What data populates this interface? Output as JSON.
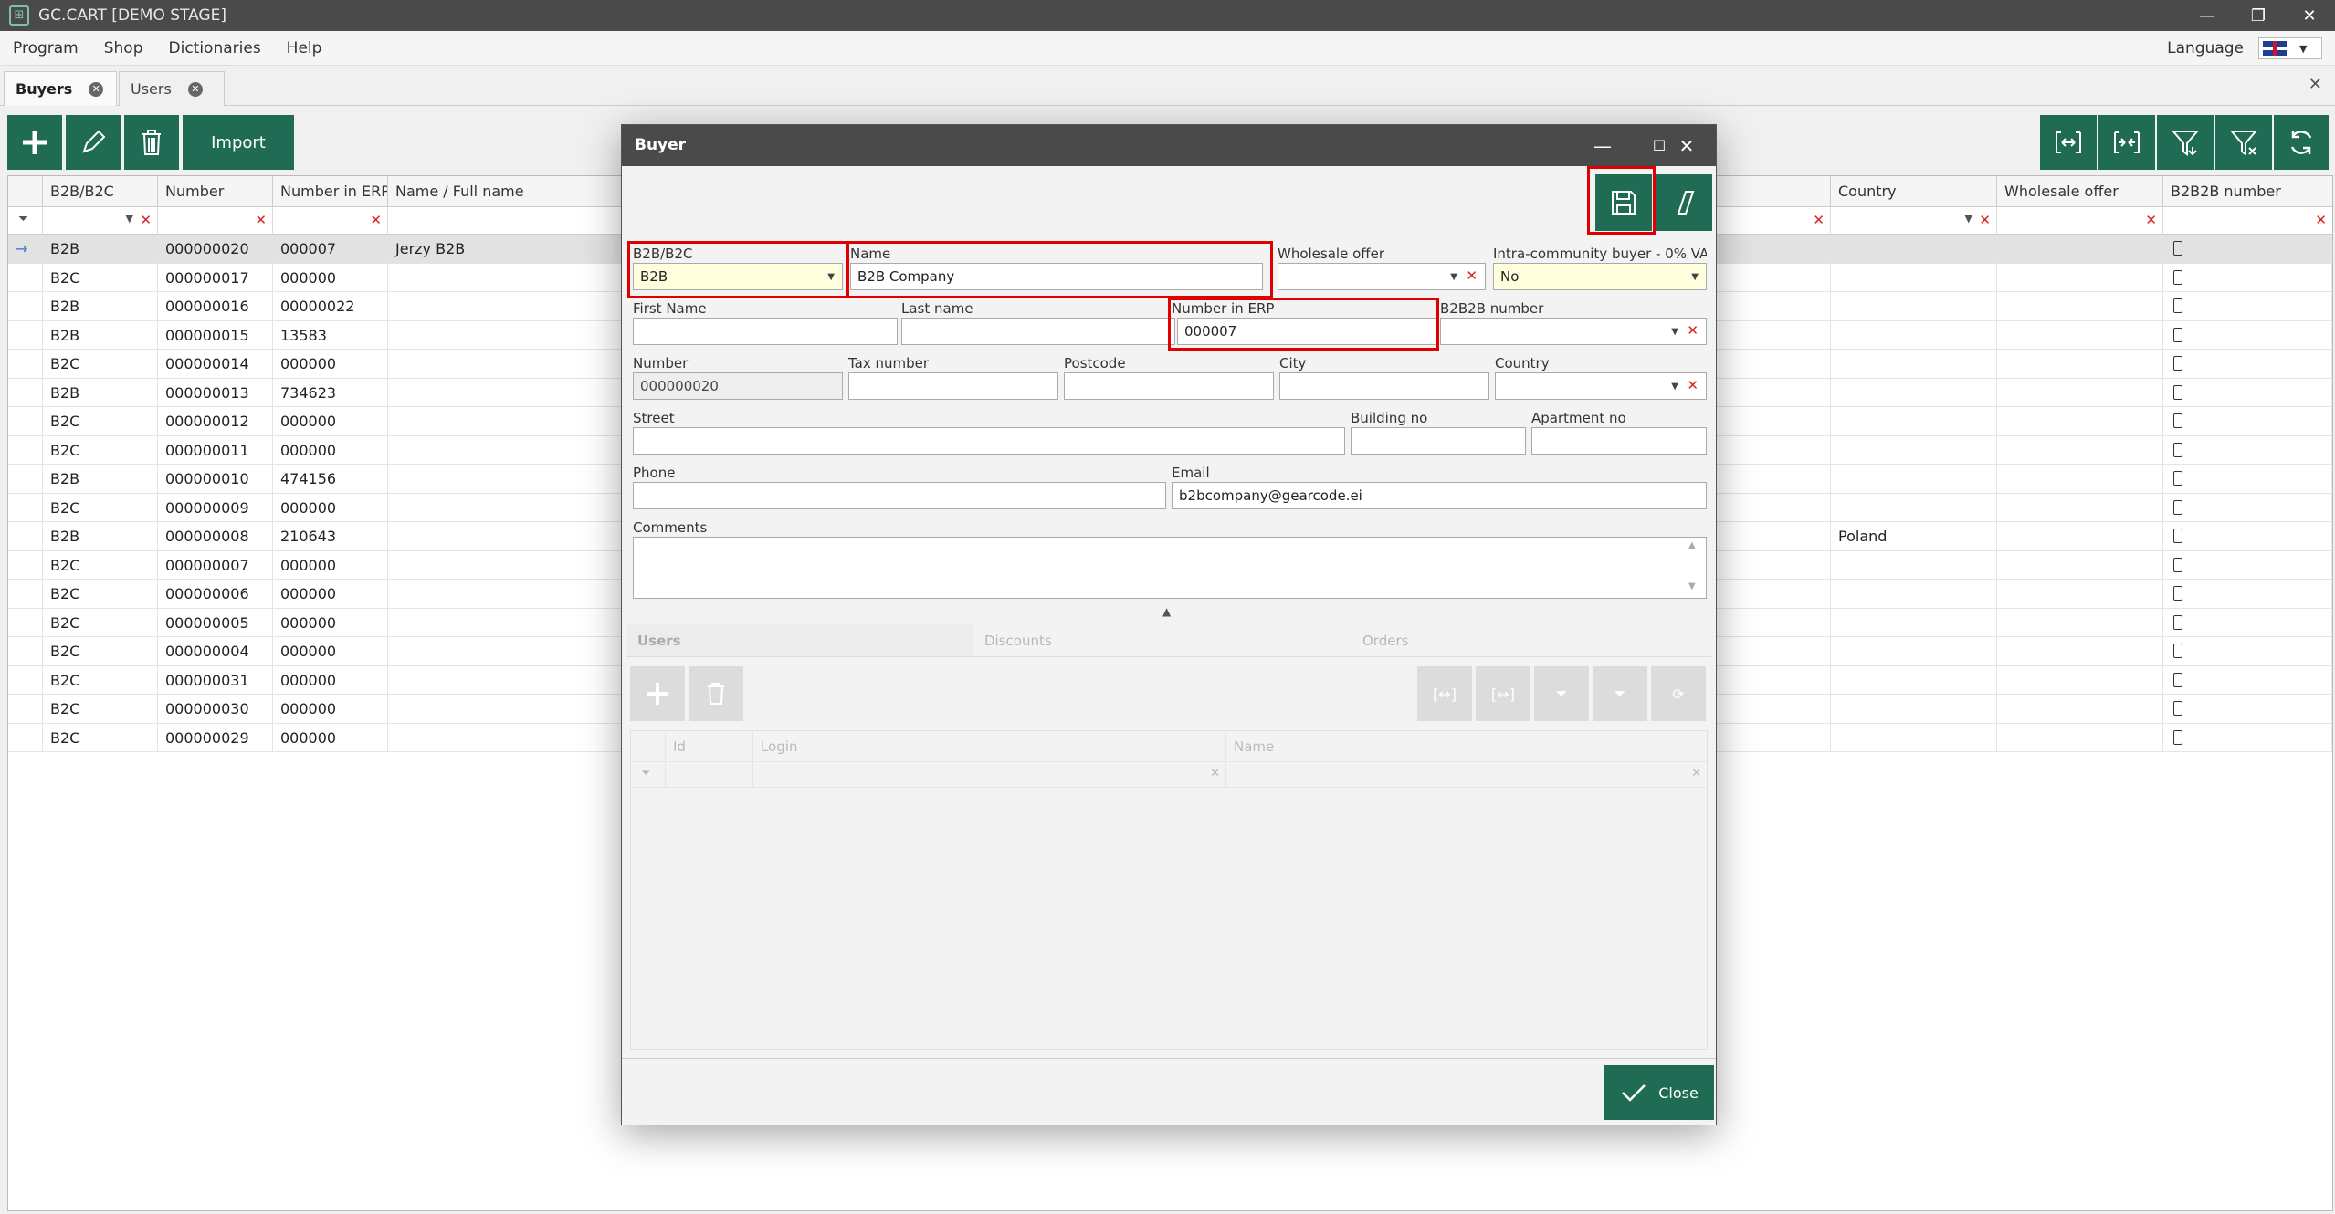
{
  "app": {
    "title": "GC.CART [DEMO STAGE]"
  },
  "menu": {
    "items": [
      "Program",
      "Shop",
      "Dictionaries",
      "Help"
    ],
    "language_label": "Language"
  },
  "tabs": [
    {
      "label": "Buyers"
    },
    {
      "label": "Users"
    }
  ],
  "toolbar": {
    "import_label": "Import"
  },
  "grid": {
    "columns": [
      "B2B/B2C",
      "Number",
      "Number in ERP",
      "Name / Full name",
      "Country",
      "Wholesale offer",
      "B2B2B number"
    ],
    "rows": [
      {
        "type": "B2B",
        "number": "000000020",
        "erp": "000007",
        "name": "Jerzy B2B",
        "country": ""
      },
      {
        "type": "B2C",
        "number": "000000017",
        "erp": "000000",
        "name": "",
        "country": ""
      },
      {
        "type": "B2B",
        "number": "000000016",
        "erp": "00000022",
        "name": "",
        "country": ""
      },
      {
        "type": "B2B",
        "number": "000000015",
        "erp": "13583",
        "name": "",
        "country": ""
      },
      {
        "type": "B2C",
        "number": "000000014",
        "erp": "000000",
        "name": "",
        "country": ""
      },
      {
        "type": "B2B",
        "number": "000000013",
        "erp": "734623",
        "name": "",
        "country": ""
      },
      {
        "type": "B2C",
        "number": "000000012",
        "erp": "000000",
        "name": "",
        "country": ""
      },
      {
        "type": "B2C",
        "number": "000000011",
        "erp": "000000",
        "name": "",
        "country": ""
      },
      {
        "type": "B2B",
        "number": "000000010",
        "erp": "474156",
        "name": "",
        "country": ""
      },
      {
        "type": "B2C",
        "number": "000000009",
        "erp": "000000",
        "name": "",
        "country": ""
      },
      {
        "type": "B2B",
        "number": "000000008",
        "erp": "210643",
        "name": "",
        "country": "Poland"
      },
      {
        "type": "B2C",
        "number": "000000007",
        "erp": "000000",
        "name": "",
        "country": ""
      },
      {
        "type": "B2C",
        "number": "000000006",
        "erp": "000000",
        "name": "",
        "country": ""
      },
      {
        "type": "B2C",
        "number": "000000005",
        "erp": "000000",
        "name": "",
        "country": ""
      },
      {
        "type": "B2C",
        "number": "000000004",
        "erp": "000000",
        "name": "",
        "country": ""
      },
      {
        "type": "B2C",
        "number": "000000031",
        "erp": "000000",
        "name": "",
        "country": ""
      },
      {
        "type": "B2C",
        "number": "000000030",
        "erp": "000000",
        "name": "",
        "country": ""
      },
      {
        "type": "B2C",
        "number": "000000029",
        "erp": "000000",
        "name": "",
        "country": ""
      }
    ]
  },
  "dialog": {
    "title": "Buyer",
    "fields": {
      "b2b_b2c": {
        "label": "B2B/B2C",
        "value": "B2B"
      },
      "name": {
        "label": "Name",
        "value": "B2B Company"
      },
      "wholesale_offer": {
        "label": "Wholesale offer",
        "value": ""
      },
      "intra_community": {
        "label": "Intra-community buyer - 0% VAT",
        "value": "No"
      },
      "first_name": {
        "label": "First Name",
        "value": ""
      },
      "last_name": {
        "label": "Last name",
        "value": ""
      },
      "number_in_erp": {
        "label": "Number in ERP",
        "value": "000007"
      },
      "b2b2b_number": {
        "label": "B2B2B number",
        "value": ""
      },
      "number": {
        "label": "Number",
        "value": "000000020"
      },
      "tax_number": {
        "label": "Tax number",
        "value": ""
      },
      "postcode": {
        "label": "Postcode",
        "value": ""
      },
      "city": {
        "label": "City",
        "value": ""
      },
      "country": {
        "label": "Country",
        "value": ""
      },
      "street": {
        "label": "Street",
        "value": ""
      },
      "building_no": {
        "label": "Building no",
        "value": ""
      },
      "apartment_no": {
        "label": "Apartment no",
        "value": ""
      },
      "phone": {
        "label": "Phone",
        "value": ""
      },
      "email": {
        "label": "Email",
        "value": "b2bcompany@gearcode.ei"
      },
      "comments": {
        "label": "Comments",
        "value": ""
      }
    },
    "subtabs": [
      "Users",
      "Discounts",
      "Orders"
    ],
    "subgrid_columns": [
      "Id",
      "Login",
      "Name"
    ],
    "close_label": "Close"
  },
  "colors": {
    "accent": "#1f6b53",
    "titlebar": "#4a4a4a",
    "highlight": "#e00000"
  }
}
